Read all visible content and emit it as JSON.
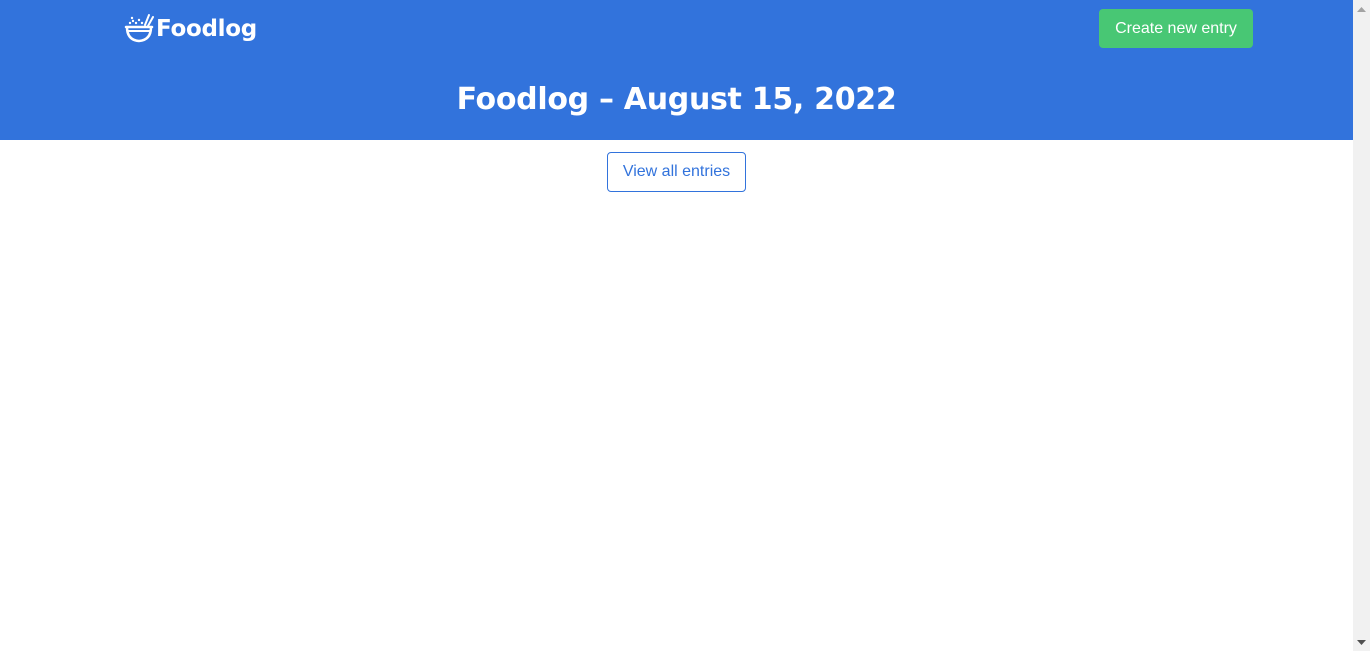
{
  "header": {
    "brand_name": "Foodlog",
    "brand_icon": "bowl-icon",
    "create_button_label": "Create new entry",
    "page_title": "Foodlog – August 15, 2022"
  },
  "main": {
    "view_all_button_label": "View all entries"
  },
  "colors": {
    "primary": "#3273dc",
    "success": "#48c774",
    "text_on_primary": "#ffffff",
    "background": "#ffffff"
  }
}
